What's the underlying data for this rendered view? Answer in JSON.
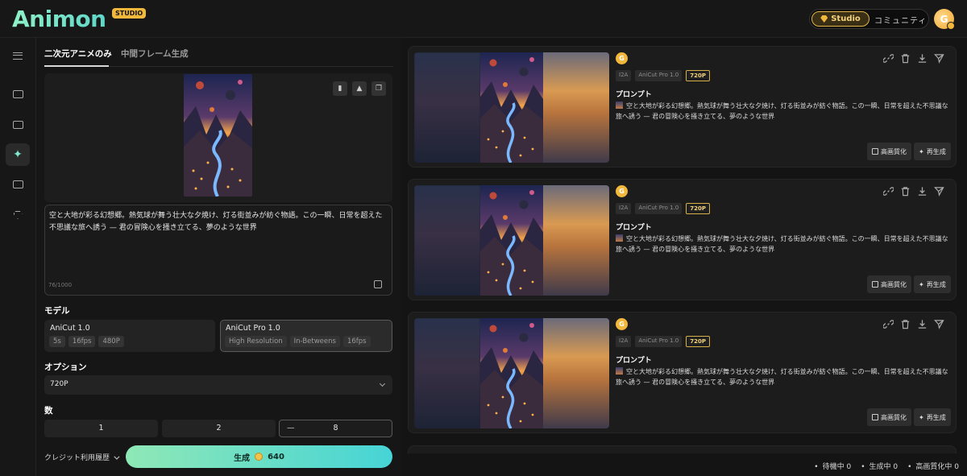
{
  "header": {
    "logo": "Animon",
    "logo_badge": "STUDIO",
    "studio_label": "Studio",
    "community_label": "コミュニティ",
    "avatar_letter": "G"
  },
  "tabs": [
    {
      "label": "二次元アニメのみ",
      "active": true
    },
    {
      "label": "中間フレーム生成",
      "active": false
    }
  ],
  "prompt": {
    "text": "空と大地が彩る幻想郷。熱気球が舞う壮大な夕焼け、灯る街並みが紡ぐ物語。この一瞬、日常を超えた不思議な旅へ誘う — 君の冒険心を掻き立てる、夢のような世界",
    "counter": "76/1000"
  },
  "model": {
    "label": "モデル",
    "options": [
      {
        "name": "AniCut 1.0",
        "tags": [
          "5s",
          "16fps",
          "480P"
        ],
        "selected": false
      },
      {
        "name": "AniCut Pro 1.0",
        "tags": [
          "High Resolution",
          "In-Betweens",
          "16fps"
        ],
        "selected": true
      }
    ]
  },
  "option": {
    "label": "オプション",
    "value": "720P"
  },
  "count": {
    "label": "数",
    "values": [
      "1",
      "2",
      "8"
    ],
    "minus": "—"
  },
  "credit_history": "クレジット利用履歴",
  "generate": {
    "label": "生成",
    "cost": "640"
  },
  "results": {
    "avatar_letter": "G",
    "tags": [
      "I2A",
      "AniCut Pro 1.0",
      "720P"
    ],
    "prompt_label": "プロンプト",
    "prompt_text": "空と大地が彩る幻想郷。熱気球が舞う壮大な夕焼け、灯る街並みが紡ぐ物語。この一瞬、日常を超えた不思議な旅へ誘う — 君の冒険心を掻き立てる、夢のような世界",
    "upscale_label": "高画質化",
    "regenerate_label": "再生成"
  },
  "status": {
    "waiting": "待機中 0",
    "generating": "生成中 0",
    "upscaling": "高画質化中 0"
  },
  "colors": {
    "accent": "#7fe7d0",
    "gold": "#f2b83c",
    "generate_gradient_start": "#8fe8b6",
    "generate_gradient_end": "#46d4d6"
  }
}
